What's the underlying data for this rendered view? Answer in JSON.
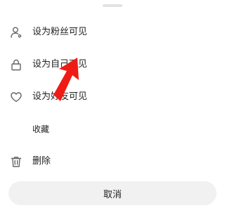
{
  "accent_color": "#ee1c14",
  "menu": {
    "items": [
      {
        "label": "设为粉丝可见",
        "icon": "person-icon"
      },
      {
        "label": "设为自己可见",
        "icon": "lock-icon"
      },
      {
        "label": "设为好友可见",
        "icon": "heart-icon"
      },
      {
        "label": "收藏",
        "icon": ""
      },
      {
        "label": "删除",
        "icon": "trash-icon"
      }
    ]
  },
  "cancel_label": "取消"
}
